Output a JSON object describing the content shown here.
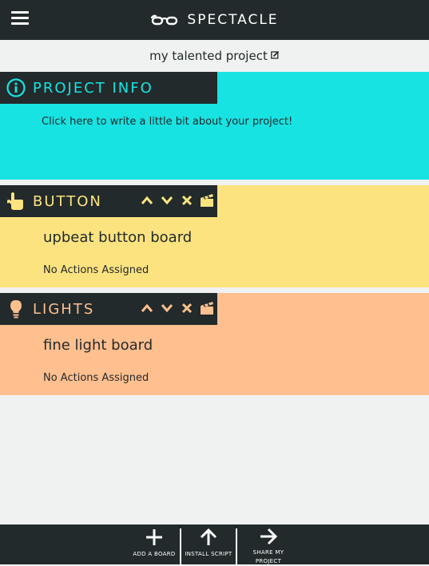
{
  "app": {
    "brand_title": "SPECTACLE",
    "menu_icon": "hamburger-menu-icon",
    "logo_icon": "spectacles-logo-icon"
  },
  "project": {
    "title": "my talented project",
    "edit_icon": "edit-icon"
  },
  "info": {
    "label": "PROJECT INFO",
    "icon": "info-icon",
    "description": "Click here to write a little bit about your project!",
    "color": "#18e3e3"
  },
  "boards": [
    {
      "label": "BUTTON",
      "icon": "hand-pointer-icon",
      "name": "upbeat button board",
      "actions": "No Actions Assigned",
      "color": "#fde380"
    },
    {
      "label": "LIGHTS",
      "icon": "lightbulb-icon",
      "name": "fine light board",
      "actions": "No Actions Assigned",
      "color": "#ffbf8f"
    }
  ],
  "bottom": {
    "add_label": "ADD A BOARD",
    "install_label": "INSTALL SCRIPT",
    "share_label": "SHARE MY PROJECT"
  },
  "theme": {
    "dark": "#222a2b",
    "background": "#f0f2f2"
  }
}
